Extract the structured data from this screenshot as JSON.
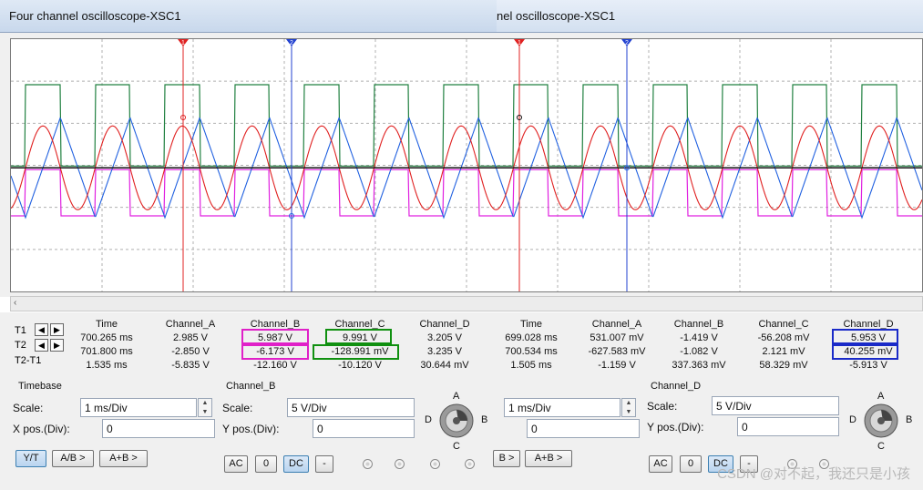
{
  "window": {
    "title_left": "Four channel oscilloscope-XSC1",
    "title_right": "nel oscilloscope-XSC1"
  },
  "colors": {
    "channel_a": "#e02020",
    "channel_b": "#2060e0",
    "channel_c": "#208040",
    "channel_d": "#e020e0",
    "cursor_t1": "#e02020",
    "cursor_t2": "#2040d0",
    "highlight_magenta": "#e020c8",
    "highlight_green": "#109010",
    "highlight_blue": "#1a2ac8"
  },
  "scroll_left_arrow": "‹",
  "readouts_left": {
    "row_labels": [
      "T1",
      "T2",
      "T2-T1"
    ],
    "headers": [
      "Time",
      "Channel_A",
      "Channel_B",
      "Channel_C",
      "Channel_D"
    ],
    "rows": [
      [
        "700.265 ms",
        "2.985 V",
        "5.987 V",
        "9.991 V",
        "3.205 V"
      ],
      [
        "701.800 ms",
        "-2.850 V",
        "-6.173 V",
        "-128.991 mV",
        "3.235 V"
      ],
      [
        "1.535 ms",
        "-5.835 V",
        "-12.160 V",
        "-10.120 V",
        "30.644 mV"
      ]
    ]
  },
  "readouts_right": {
    "headers": [
      "Time",
      "Channel_A",
      "Channel_B",
      "Channel_C",
      "Channel_D"
    ],
    "rows": [
      [
        "699.028 ms",
        "531.007 mV",
        "-1.419 V",
        "-56.208 mV",
        "5.953 V"
      ],
      [
        "700.534 ms",
        "-627.583 mV",
        "-1.082 V",
        "2.121 mV",
        "40.255 mV"
      ],
      [
        "1.505 ms",
        "-1.159 V",
        "337.363 mV",
        "58.329 mV",
        "-5.913 V"
      ]
    ]
  },
  "nav_arrows": {
    "left": "◀",
    "right": "▶"
  },
  "timebase": {
    "label": "Timebase",
    "scale_label": "Scale:",
    "scale_value": "1 ms/Div",
    "xpos_label": "X pos.(Div):",
    "xpos_value": "0",
    "buttons": [
      "Y/T",
      "A/B >",
      "A+B >"
    ]
  },
  "channel_b": {
    "label": "Channel_B",
    "scale_label": "Scale:",
    "scale_value": "5  V/Div",
    "ypos_label": "Y pos.(Div):",
    "ypos_value": "0",
    "coupling": [
      "AC",
      "0",
      "DC",
      "-"
    ]
  },
  "timebase_right": {
    "scale_value": "1 ms/Div",
    "xpos_value": "0",
    "buttons": [
      "B >",
      "A+B >"
    ]
  },
  "channel_d": {
    "label": "Channel_D",
    "scale_label": "Scale:",
    "scale_value": "5  V/Div",
    "ypos_label": "Y pos.(Div):",
    "ypos_value": "0",
    "coupling": [
      "AC",
      "0",
      "DC",
      "-"
    ]
  },
  "knob_labels": {
    "a": "A",
    "b": "B",
    "c": "C",
    "d": "D"
  },
  "cursor_markers": {
    "t1": "1",
    "t2": "2"
  },
  "watermark": "CSDN @对不起，我还只是小孩"
}
